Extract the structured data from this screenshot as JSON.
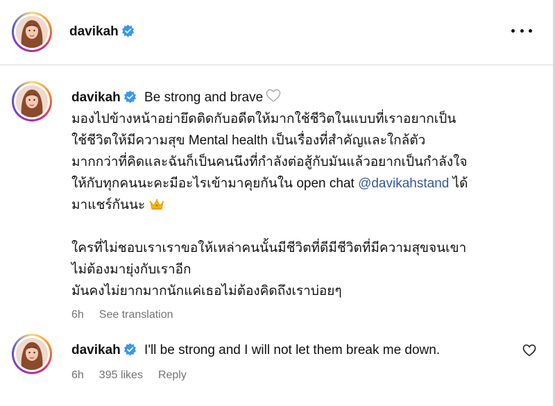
{
  "post": {
    "username": "davikah"
  },
  "caption": {
    "username": "davikah",
    "first_text": "Be strong and brave",
    "lines": [
      "มองไปข้างหน้าอย่ายึดติดกับอดีตให้มากใช้ชีวิตในแบบที่เราอยากเป็น",
      "ใช้ชีวิตให้มีความสุข Mental health เป็นเรื่องที่สำคัญและใกล้ตัว",
      "มากกว่าที่คิดและฉันก็เป็นคนนึงที่กำลังต่อสู้กับมันแล้วอยากเป็นกำลังใจ"
    ],
    "line4_before": "ให้กับทุกคนนะคะมีอะไรเข้ามาคุยกันใน open chat ",
    "mention": "@davikahstand",
    "line4_after": " ได้",
    "line5": "มาแชร์กันนะ",
    "lines_b": [
      "ใครที่ไม่ชอบเราเราขอให้เหล่าคนนั้นมีชีวิตที่ดีมีชีวิตที่มีความสุขจนเขา",
      "ไม่ต้องมายุ่งกับเราอีก",
      "มันคงไม่ยากมากนักแค่เธอไม่ต้องคิดถึงเราบ่อยๆ"
    ],
    "time": "6h",
    "see_translation": "See translation"
  },
  "reply": {
    "username": "davikah",
    "text": "I'll be strong and I will not let them break me down.",
    "time": "6h",
    "likes": "395 likes",
    "reply_label": "Reply"
  },
  "colors": {
    "verified": "#3897f0",
    "link": "#385898",
    "meta": "#737373"
  },
  "icons": [
    "verified-badge-icon",
    "more-options-icon",
    "heart-outline-icon",
    "crown-emoji-icon",
    "like-heart-icon"
  ]
}
